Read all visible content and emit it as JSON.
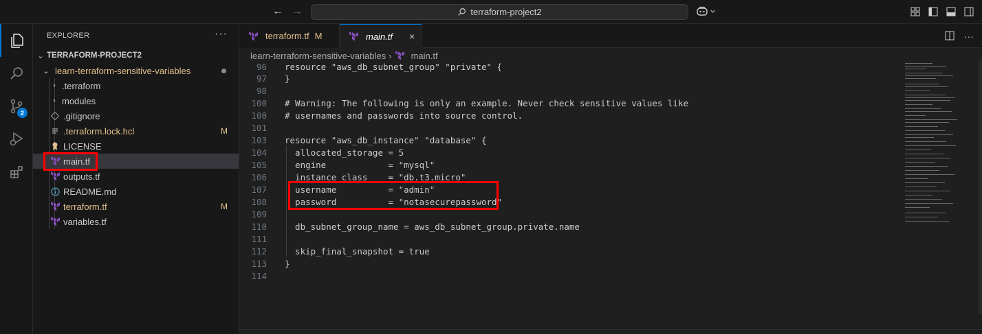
{
  "titlebar": {
    "search_text": "terraform-project2"
  },
  "activitybar": {
    "items": [
      {
        "name": "explorer-icon"
      },
      {
        "name": "search-icon"
      },
      {
        "name": "source-control-icon",
        "badge": "2"
      },
      {
        "name": "run-debug-icon"
      },
      {
        "name": "extensions-icon"
      }
    ]
  },
  "sidebar": {
    "title": "EXPLORER",
    "more": "···",
    "project": "TERRAFORM-PROJECT2",
    "items": [
      {
        "label": "learn-terraform-sensitive-variables",
        "type": "folder-open"
      },
      {
        "label": ".terraform",
        "type": "folder"
      },
      {
        "label": "modules",
        "type": "folder"
      },
      {
        "label": ".gitignore",
        "type": "file"
      },
      {
        "label": ".terraform.lock.hcl",
        "type": "file",
        "status": "M"
      },
      {
        "label": "LICENSE",
        "type": "file"
      },
      {
        "label": "main.tf",
        "type": "file"
      },
      {
        "label": "outputs.tf",
        "type": "file"
      },
      {
        "label": "README.md",
        "type": "file"
      },
      {
        "label": "terraform.tf",
        "type": "file",
        "status": "M"
      },
      {
        "label": "variables.tf",
        "type": "file"
      }
    ]
  },
  "editor": {
    "tabs": [
      {
        "label": "terraform.tf",
        "status": "M"
      },
      {
        "label": "main.tf",
        "close": "×"
      }
    ],
    "breadcrumb": [
      "learn-terraform-sensitive-variables",
      "main.tf"
    ],
    "lines": [
      {
        "n": "96",
        "text": "resource \"aws_db_subnet_group\" \"private\" {"
      },
      {
        "n": "97",
        "text": "}"
      },
      {
        "n": "98",
        "text": ""
      },
      {
        "n": "100",
        "text": "# Warning: The following is only an example. Never check sensitive values like"
      },
      {
        "n": "100",
        "text": "# usernames and passwords into source control."
      },
      {
        "n": "101",
        "text": ""
      },
      {
        "n": "103",
        "text": "resource \"aws_db_instance\" \"database\" {"
      },
      {
        "n": "104",
        "text": "  allocated_storage = 5"
      },
      {
        "n": "105",
        "text": "  engine            = \"mysql\""
      },
      {
        "n": "106",
        "text": "  instance_class    = \"db.t3.micro\""
      },
      {
        "n": "107",
        "text": "  username          = \"admin\""
      },
      {
        "n": "108",
        "text": "  password          = \"notasecurepassword\""
      },
      {
        "n": "109",
        "text": ""
      },
      {
        "n": "110",
        "text": "  db_subnet_group_name = aws_db_subnet_group.private.name"
      },
      {
        "n": "111",
        "text": ""
      },
      {
        "n": "112",
        "text": "  skip_final_snapshot = true"
      },
      {
        "n": "113",
        "text": "}"
      },
      {
        "n": "114",
        "text": ""
      }
    ]
  },
  "colors": {
    "accent": "#0078d4",
    "modified": "#e2c08d",
    "highlight": "#ff0000",
    "terraform": "#7b42bc"
  }
}
